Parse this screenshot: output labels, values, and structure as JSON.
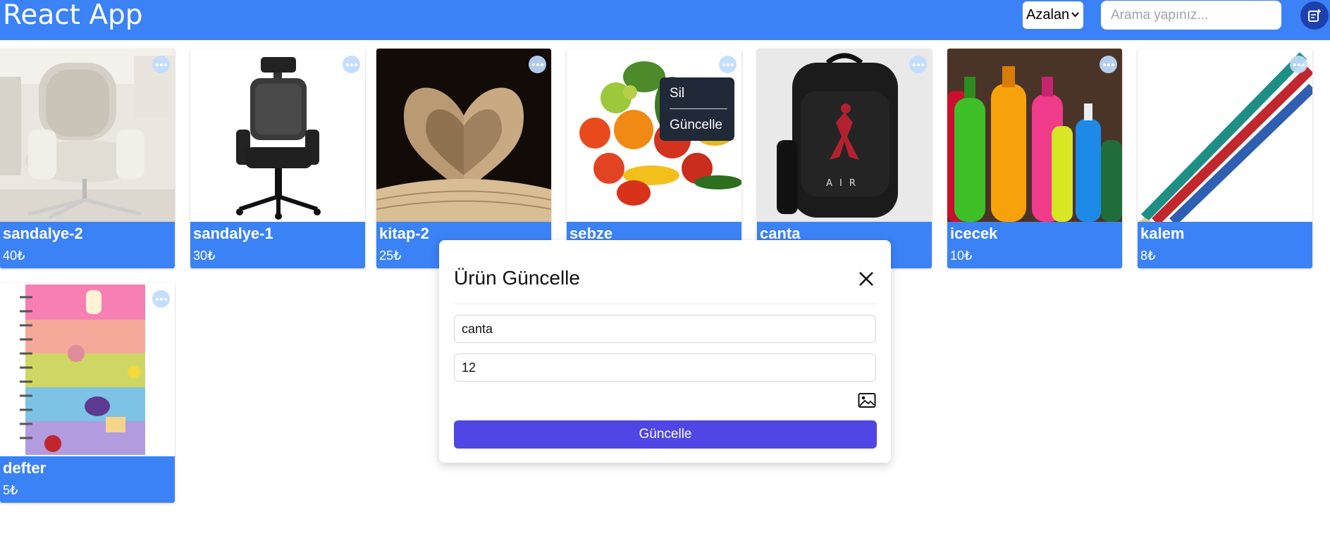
{
  "header": {
    "app_title": "React App",
    "sort_value": "Azalan",
    "search_placeholder": "Arama yapınız...",
    "accent_color": "#3b82f6"
  },
  "products": [
    {
      "name": "sandalye-2",
      "price": "40₺",
      "image": "white office chair"
    },
    {
      "name": "sandalye-1",
      "price": "30₺",
      "image": "black office chair"
    },
    {
      "name": "kitap-2",
      "price": "25₺",
      "image": "open book heart pages"
    },
    {
      "name": "sebze",
      "price": "",
      "image": "vegetables"
    },
    {
      "name": "canta",
      "price": "",
      "image": "black backpack"
    },
    {
      "name": "icecek",
      "price": "10₺",
      "image": "soft drink bottles"
    },
    {
      "name": "kalem",
      "price": "8₺",
      "image": "colored pencils"
    },
    {
      "name": "defter",
      "price": "5₺",
      "image": "rainbow notebook"
    }
  ],
  "context_menu": {
    "delete_label": "Sil",
    "update_label": "Güncelle"
  },
  "modal": {
    "title": "Ürün Güncelle",
    "name_value": "canta",
    "price_value": "12",
    "submit_label": "Güncelle",
    "button_color": "#4f46e5"
  }
}
